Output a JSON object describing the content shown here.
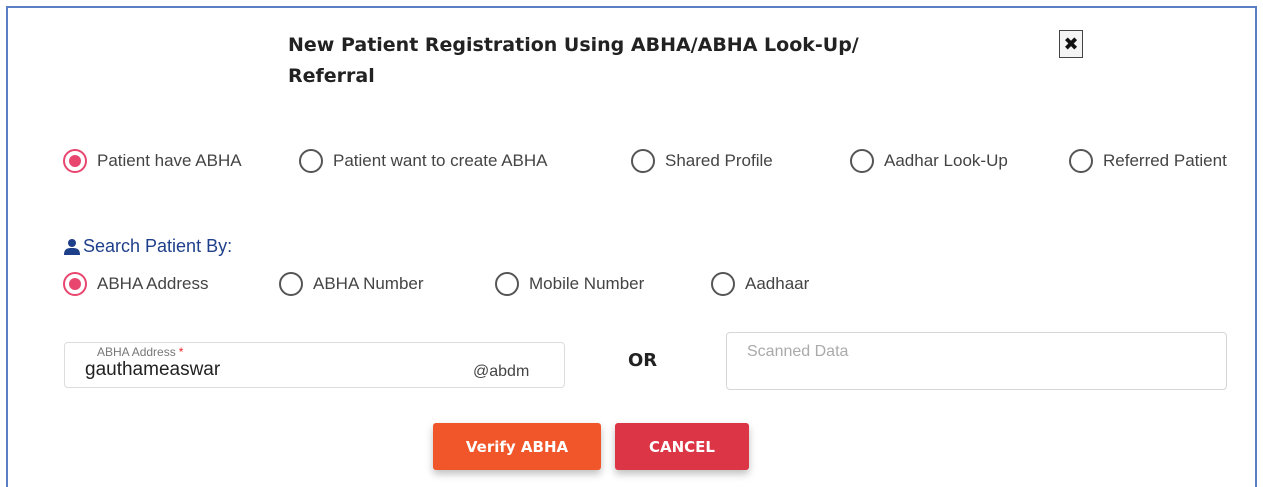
{
  "dialog": {
    "title_line1": "New Patient Registration Using ABHA/ABHA Look-Up/",
    "title_line2": "Referral",
    "close_glyph": "✖"
  },
  "patient_type": {
    "selected": "Patient have ABHA",
    "options": [
      "Patient have ABHA",
      "Patient want to create ABHA",
      "Shared Profile",
      "Aadhar Look-Up",
      "Referred Patient"
    ]
  },
  "search": {
    "heading": "Search Patient By:",
    "selected": "ABHA Address",
    "options": [
      "ABHA Address",
      "ABHA Number",
      "Mobile Number",
      "Aadhaar"
    ]
  },
  "abha_field": {
    "label": "ABHA Address",
    "required_mark": "*",
    "value": "gauthameaswar",
    "suffix": "@abdm"
  },
  "or_label": "OR",
  "scanned": {
    "placeholder": "Scanned Data"
  },
  "buttons": {
    "verify": "Verify ABHA",
    "cancel": "CANCEL"
  },
  "colors": {
    "frame_border": "#5b7fc4",
    "radio_selected": "#e8466f",
    "heading": "#1e3f8a",
    "verify_button": "#f0562a",
    "cancel_button": "#dc3545"
  },
  "icons": {
    "heading_icon": "user-icon",
    "close": "close-icon"
  }
}
